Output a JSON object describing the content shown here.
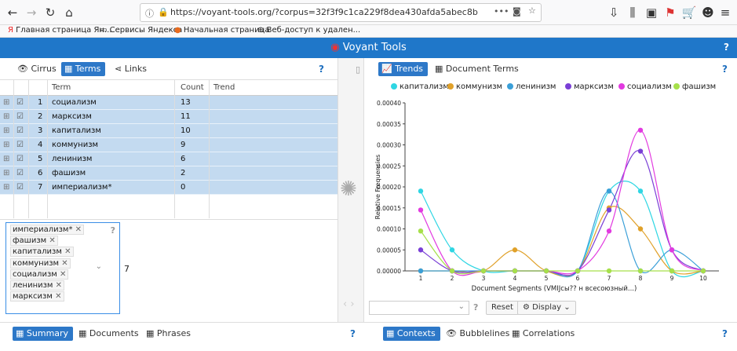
{
  "browser": {
    "url": "https://voyant-tools.org/?corpus=32f3f9c1ca229f8dea430afda5abec8b",
    "bookmarks": [
      "Главная страница Ян...",
      "Сервисы Яндекса",
      "Начальная страница",
      "Веб-доступ к удален..."
    ],
    "more_label": "•••"
  },
  "app": {
    "title": "Voyant Tools",
    "help": "?"
  },
  "left_panel": {
    "tabs": [
      "Cirrus",
      "Terms",
      "Links"
    ],
    "active_tab": "Terms",
    "columns": {
      "term": "Term",
      "count": "Count",
      "trend": "Trend"
    },
    "rows": [
      {
        "n": "1",
        "term": "социализм",
        "count": "13"
      },
      {
        "n": "2",
        "term": "марксизм",
        "count": "11"
      },
      {
        "n": "3",
        "term": "капитализм",
        "count": "10"
      },
      {
        "n": "4",
        "term": "коммунизм",
        "count": "9"
      },
      {
        "n": "5",
        "term": "ленинизм",
        "count": "6"
      },
      {
        "n": "6",
        "term": "фашизм",
        "count": "2"
      },
      {
        "n": "7",
        "term": "империализм*",
        "count": "0"
      }
    ],
    "stoplist": [
      "империализм*",
      "фашизм",
      "капитализм",
      "коммунизм",
      "социализм",
      "ленинизм",
      "марксизм"
    ],
    "stoplist_count": "7"
  },
  "right_panel": {
    "tabs": [
      "Trends",
      "Document Terms"
    ],
    "active_tab": "Trends",
    "reset_label": "Reset",
    "display_label": "Display"
  },
  "bottom_left": {
    "tabs": [
      "Summary",
      "Documents",
      "Phrases"
    ],
    "active_tab": "Summary"
  },
  "bottom_right": {
    "tabs": [
      "Contexts",
      "Bubblelines",
      "Correlations"
    ],
    "active_tab": "Contexts"
  },
  "chart_data": {
    "type": "line",
    "ylabel": "Relative Frequencies",
    "xlabel": "Document Segments (VMIJcы?? н всесоюзный...)",
    "x": [
      1,
      2,
      3,
      4,
      5,
      6,
      7,
      8,
      9,
      10
    ],
    "yticks": [
      "0.00000",
      "0.00005",
      "0.00010",
      "0.00015",
      "0.00020",
      "0.00025",
      "0.00030",
      "0.00035",
      "0.00040"
    ],
    "ylim": [
      0,
      0.0004
    ],
    "series": [
      {
        "name": "капитализм",
        "color": "#2fd6e3",
        "values": [
          0.00019,
          5e-05,
          0,
          0,
          0,
          0,
          0.00019,
          0.00019,
          0,
          0
        ]
      },
      {
        "name": "коммунизм",
        "color": "#e0a12a",
        "values": [
          0,
          0,
          0,
          5e-05,
          0,
          0,
          0.00015,
          0.0001,
          0,
          0
        ]
      },
      {
        "name": "ленинизм",
        "color": "#3a9fd8",
        "values": [
          0,
          0,
          0,
          0,
          0,
          0,
          0.00019,
          0,
          5e-05,
          0
        ]
      },
      {
        "name": "марксизм",
        "color": "#7a3fd6",
        "values": [
          5e-05,
          0,
          0,
          0,
          0,
          0,
          0.000145,
          0.000285,
          5e-05,
          0
        ]
      },
      {
        "name": "социализм",
        "color": "#e23ae0",
        "values": [
          0.000145,
          0,
          0,
          0,
          0,
          0,
          9.5e-05,
          0.000335,
          5e-05,
          0
        ]
      },
      {
        "name": "фашизм",
        "color": "#a6e04a",
        "values": [
          9.5e-05,
          0,
          0,
          0,
          0,
          0,
          0,
          0,
          0,
          0
        ]
      }
    ]
  }
}
